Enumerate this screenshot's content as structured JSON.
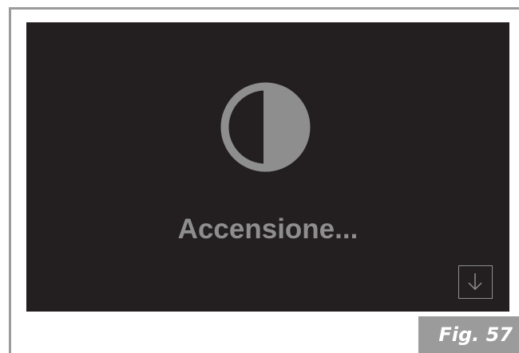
{
  "screen": {
    "status_icon": "half-circle-brightness-icon",
    "status_text": "Accensione...",
    "down_button_icon": "arrow-down-icon"
  },
  "figure": {
    "label": "Fig. 57"
  },
  "colors": {
    "screen_background": "#231f20",
    "foreground_gray": "#8e8e8f",
    "frame_gray": "#9b9b9b",
    "page_background": "#ffffff"
  }
}
